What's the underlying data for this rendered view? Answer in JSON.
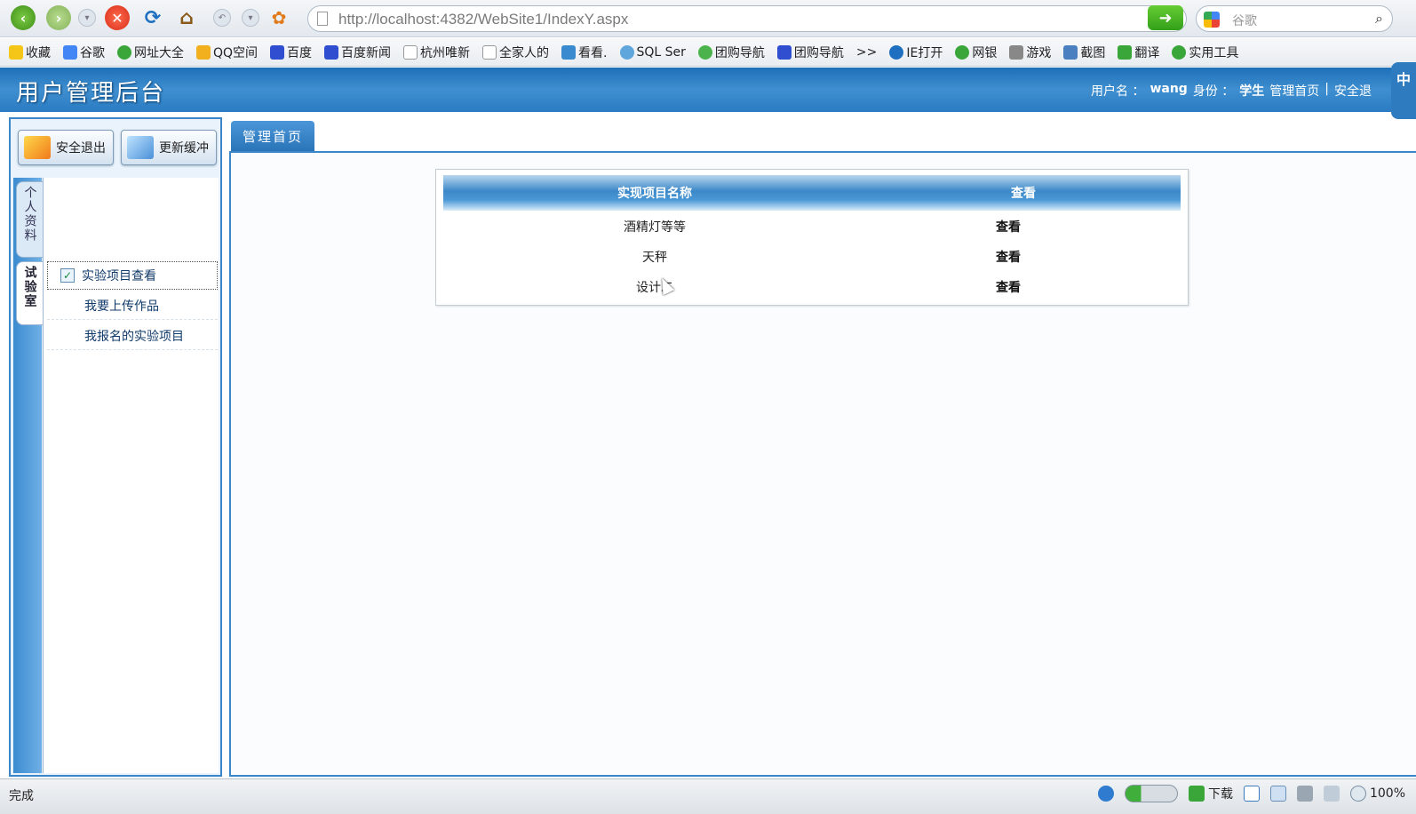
{
  "browser": {
    "url": "http://localhost:4382/WebSite1/IndexY.aspx",
    "search_placeholder": "谷歌",
    "favorites": [
      "收藏",
      "谷歌",
      "网址大全",
      "QQ空间",
      "百度",
      "百度新闻",
      "杭州唯新",
      "全家人的",
      "看看.",
      "SQL Ser",
      "团购导航",
      "团购导航",
      ">>",
      "IE打开",
      "网银",
      "游戏",
      "截图",
      "翻译",
      "实用工具"
    ],
    "status_text": "完成",
    "status_download": "下载",
    "zoom": "100%"
  },
  "header": {
    "title": "用户管理后台",
    "username_label": "用户名 ：",
    "username": "wang",
    "role_label": "身份 ：",
    "role": "学生",
    "home_link": "管理首页",
    "separator": "|",
    "logout_link": "安全退",
    "ime_label": "中"
  },
  "sidebar": {
    "logout_button": "安全退出",
    "refresh_button": "更新缓冲",
    "tabs": [
      {
        "label": "个人资料"
      },
      {
        "label": "试验室"
      }
    ],
    "items": [
      {
        "label": "实验项目查看"
      },
      {
        "label": "我要上传作品"
      },
      {
        "label": "我报名的实验项目"
      }
    ]
  },
  "main": {
    "tab_label": "管理首页",
    "table": {
      "columns": [
        "实现项目名称",
        "查看"
      ],
      "rows": [
        {
          "name": "酒精灯等等",
          "view": "查看"
        },
        {
          "name": "天秤",
          "view": "查看"
        },
        {
          "name": "设计二",
          "view": "查看"
        }
      ]
    }
  },
  "colors": {
    "header_blue": "#2a7bc2",
    "border_blue": "#3a86c8"
  }
}
